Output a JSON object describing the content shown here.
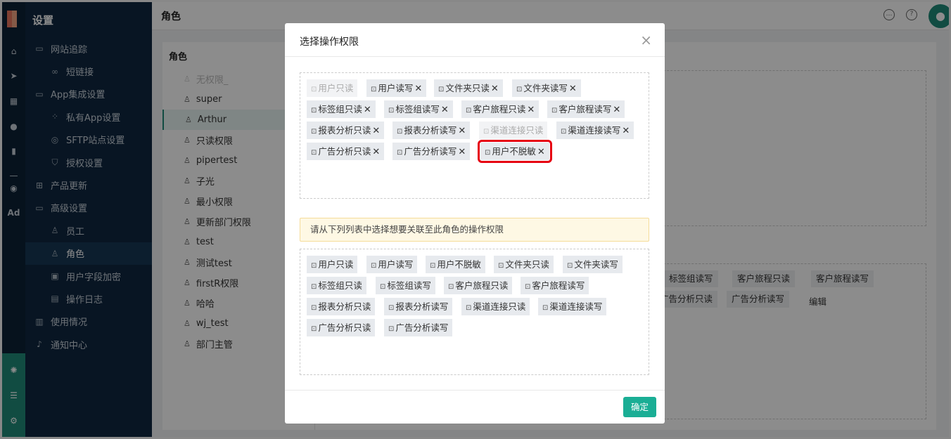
{
  "sidebar": {
    "title": "设置",
    "items": [
      {
        "label": "网站追踪",
        "icon": "folder-icon",
        "level": 1
      },
      {
        "label": "短链接",
        "icon": "link-icon",
        "level": 2
      },
      {
        "label": "App集成设置",
        "icon": "folder-icon",
        "level": 1
      },
      {
        "label": "私有App设置",
        "icon": "apps-icon",
        "level": 2
      },
      {
        "label": "SFTP站点设置",
        "icon": "globe-icon",
        "level": 2
      },
      {
        "label": "授权设置",
        "icon": "shield-icon",
        "level": 2
      },
      {
        "label": "产品更新",
        "icon": "grid-icon",
        "level": 1
      },
      {
        "label": "高级设置",
        "icon": "folder-icon",
        "level": 1
      },
      {
        "label": "员工",
        "icon": "user-icon",
        "level": 2
      },
      {
        "label": "角色",
        "icon": "role-icon",
        "level": 2,
        "active": true
      },
      {
        "label": "用户字段加密",
        "icon": "encrypt-icon",
        "level": 2
      },
      {
        "label": "操作日志",
        "icon": "log-icon",
        "level": 2
      },
      {
        "label": "使用情况",
        "icon": "usage-icon",
        "level": 1
      },
      {
        "label": "通知中心",
        "icon": "bell-icon",
        "level": 1
      }
    ]
  },
  "rail": {
    "ad_label": "Ad"
  },
  "header": {
    "title": "角色"
  },
  "roles": {
    "title": "角色",
    "items": [
      {
        "name": "无权限_",
        "disabled": true
      },
      {
        "name": "super"
      },
      {
        "name": "Arthur",
        "selected": true
      },
      {
        "name": "只读权限"
      },
      {
        "name": "pipertest"
      },
      {
        "name": "子光"
      },
      {
        "name": "最小权限"
      },
      {
        "name": "更新部门权限"
      },
      {
        "name": "test"
      },
      {
        "name": "测试test"
      },
      {
        "name": "firstR权限"
      },
      {
        "name": "哈哈"
      },
      {
        "name": "wj_test"
      },
      {
        "name": "部门主管"
      }
    ]
  },
  "background_tags": {
    "row1": [
      "标签组读写",
      "客户旅程只读",
      "客户旅程读写"
    ],
    "row2": [
      "广告分析只读",
      "广告分析读写"
    ],
    "edit": "编辑"
  },
  "modal": {
    "title": "选择操作权限",
    "close_icon": "close-icon",
    "selected": [
      {
        "label": "用户只读",
        "disabled": true
      },
      {
        "label": "用户读写"
      },
      {
        "label": "文件夹只读"
      },
      {
        "label": "文件夹读写"
      },
      {
        "label": "标签组只读"
      },
      {
        "label": "标签组读写"
      },
      {
        "label": "客户旅程只读"
      },
      {
        "label": "客户旅程读写"
      },
      {
        "label": "报表分析只读"
      },
      {
        "label": "报表分析读写"
      },
      {
        "label": "渠道连接只读",
        "disabled": true
      },
      {
        "label": "渠道连接读写"
      },
      {
        "label": "广告分析只读"
      },
      {
        "label": "广告分析读写"
      },
      {
        "label": "用户不脱敏",
        "highlighted": true
      }
    ],
    "notice": "请从下列列表中选择想要关联至此角色的操作权限",
    "available": [
      "用户只读",
      "用户读写",
      "用户不脱敏",
      "文件夹只读",
      "文件夹读写",
      "标签组只读",
      "标签组读写",
      "客户旅程只读",
      "客户旅程读写",
      "报表分析只读",
      "报表分析读写",
      "渠道连接只读",
      "渠道连接读写",
      "广告分析只读",
      "广告分析读写"
    ],
    "ok_label": "确定"
  },
  "colors": {
    "accent": "#1aae95",
    "highlight": "#e60012",
    "sidebar": "#0f2740"
  }
}
